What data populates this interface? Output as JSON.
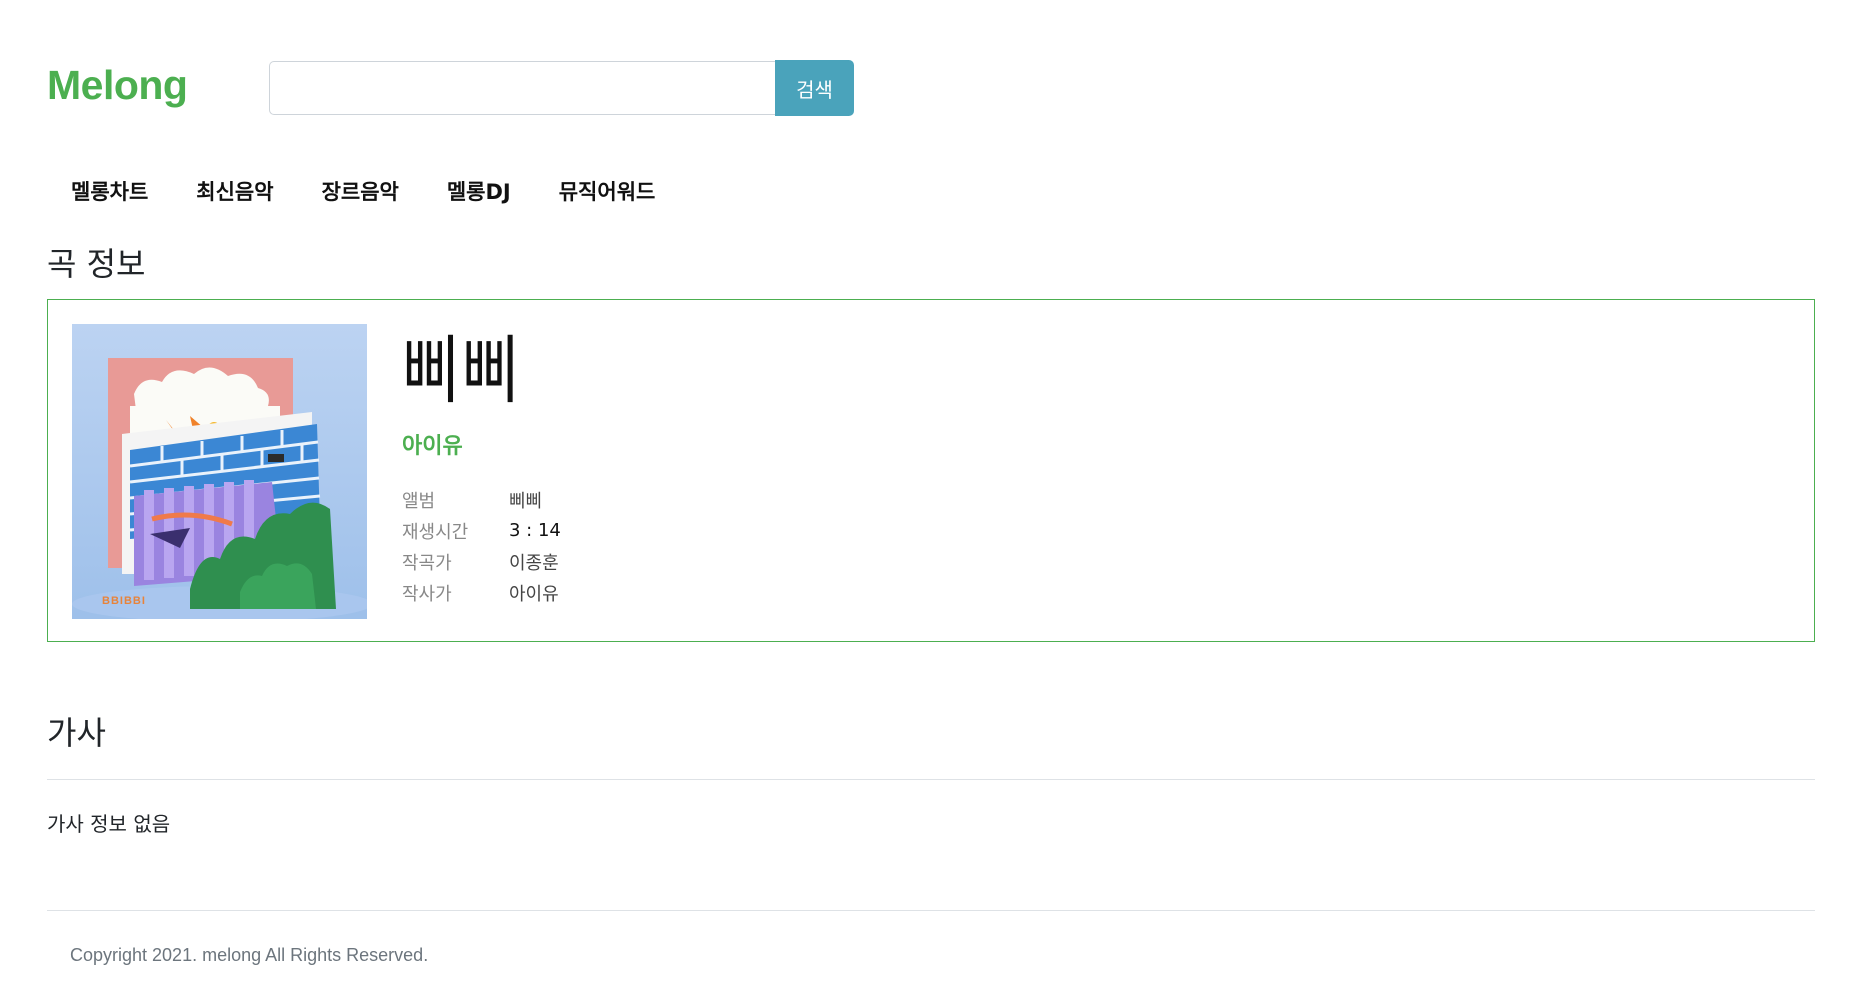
{
  "header": {
    "logo": "Melong",
    "search": {
      "value": "",
      "placeholder": "",
      "button_label": "검색"
    }
  },
  "nav": {
    "items": [
      {
        "label": "멜롱차트"
      },
      {
        "label": "최신음악"
      },
      {
        "label": "장르음악"
      },
      {
        "label": "멜롱DJ"
      },
      {
        "label": "뮤직어워드"
      }
    ]
  },
  "song_section": {
    "heading": "곡 정보",
    "cover_text": "BBIBBI",
    "title": "삐삐",
    "artist": "아이유",
    "details": [
      {
        "key": "앨범",
        "value": "삐삐"
      },
      {
        "key": "재생시간",
        "value": "3 : 14"
      },
      {
        "key": "작곡가",
        "value": "이종훈"
      },
      {
        "key": "작사가",
        "value": "아이유"
      }
    ]
  },
  "lyrics_section": {
    "heading": "가사",
    "text": "가사 정보 없음"
  },
  "footer": {
    "copyright": "Copyright 2021. melong All Rights Reserved."
  },
  "colors": {
    "brand": "#4caf50",
    "search_button": "#4aa3bb",
    "card_border": "#4caf50"
  }
}
